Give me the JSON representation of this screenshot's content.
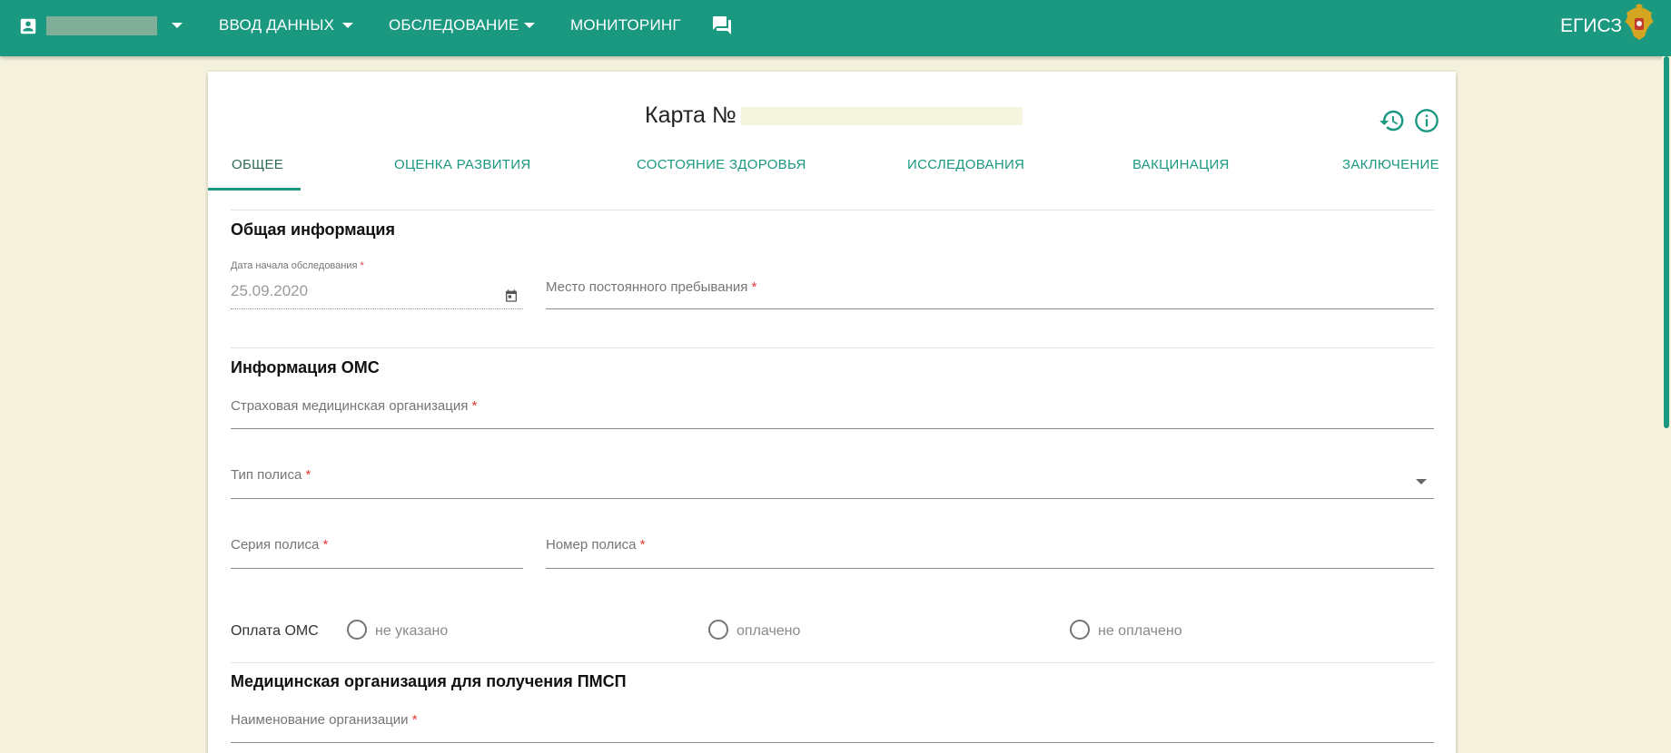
{
  "header": {
    "nav": [
      {
        "label": "ВВОД ДАННЫХ",
        "has_dropdown": true
      },
      {
        "label": "ОБСЛЕДОВАНИЕ",
        "has_dropdown": true
      },
      {
        "label": "МОНИТОРИНГ",
        "has_dropdown": false
      }
    ],
    "brand": "ЕГИСЗ",
    "icons": {
      "user": "account-box-icon",
      "chat": "chat-icon",
      "emblem": "coat-of-arms-icon"
    }
  },
  "card": {
    "title": "Карта №",
    "tabs": [
      {
        "label": "ОБЩЕЕ",
        "active": true
      },
      {
        "label": "ОЦЕНКА РАЗВИТИЯ",
        "active": false
      },
      {
        "label": "СОСТОЯНИЕ ЗДОРОВЬЯ",
        "active": false
      },
      {
        "label": "ИССЛЕДОВАНИЯ",
        "active": false
      },
      {
        "label": "ВАКЦИНАЦИЯ",
        "active": false
      },
      {
        "label": "ЗАКЛЮЧЕНИЕ",
        "active": false
      }
    ]
  },
  "general": {
    "title": "Общая информация",
    "exam_start_date": {
      "label": "Дата начала обследования",
      "value": "25.09.2020"
    },
    "residence": {
      "label": "Место постоянного пребывания"
    }
  },
  "oms": {
    "title": "Информация ОМС",
    "insurer": {
      "label": "Страховая медицинская организация"
    },
    "policy_type": {
      "label": "Тип полиса"
    },
    "policy_series": {
      "label": "Серия полиса"
    },
    "policy_number": {
      "label": "Номер полиса"
    },
    "payment": {
      "label": "Оплата ОМС",
      "options": [
        "не указано",
        "оплачено",
        "не оплачено"
      ]
    }
  },
  "pmsp": {
    "title": "Медицинская организация для получения ПМСП",
    "org_name": {
      "label": "Наименование организации"
    }
  },
  "required_mark": "*",
  "colors": {
    "primary": "#1a9880",
    "background": "#f4f2dc",
    "required": "#e53935"
  }
}
